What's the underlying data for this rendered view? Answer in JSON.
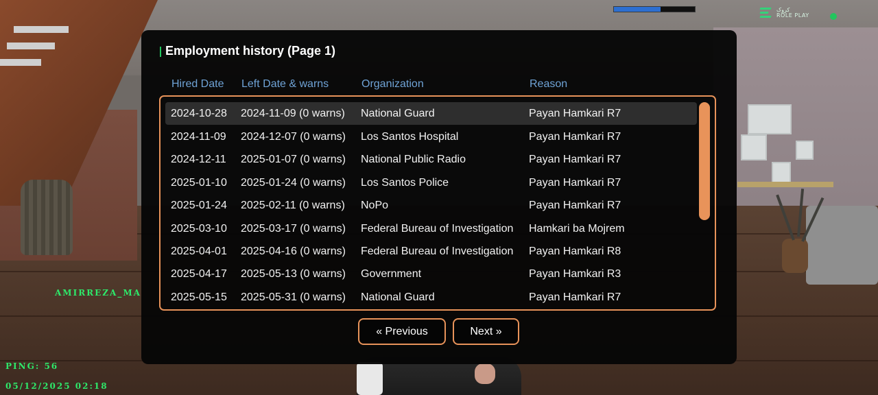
{
  "hud": {
    "health_fraction": 0.58,
    "health_color": "#2d6fd1",
    "logo_line1": "کروک",
    "logo_line2": "ROLE PLAY",
    "status_color": "#22c55e",
    "player_name": "AMIRREZA_MA",
    "ping": "PING: 56",
    "datetime": "05/12/2025 02:18"
  },
  "dialog": {
    "title": "Employment history (Page 1)",
    "columns": [
      "Hired Date",
      "Left Date & warns",
      "Organization",
      "Reason"
    ],
    "rows": [
      {
        "hired": "2024-10-28",
        "left": "2024-11-09 (0 warns)",
        "org": "National Guard",
        "reason": "Payan Hamkari R7"
      },
      {
        "hired": "2024-11-09",
        "left": "2024-12-07 (0 warns)",
        "org": "Los Santos Hospital",
        "reason": "Payan Hamkari R7"
      },
      {
        "hired": "2024-12-11",
        "left": "2025-01-07 (0 warns)",
        "org": "National Public Radio",
        "reason": "Payan Hamkari R7"
      },
      {
        "hired": "2025-01-10",
        "left": "2025-01-24 (0 warns)",
        "org": "Los Santos Police",
        "reason": "Payan Hamkari R7"
      },
      {
        "hired": "2025-01-24",
        "left": "2025-02-11 (0 warns)",
        "org": "NoPo",
        "reason": "Payan Hamkari R7"
      },
      {
        "hired": "2025-03-10",
        "left": "2025-03-17 (0 warns)",
        "org": "Federal Bureau of Investigation",
        "reason": "Hamkari ba Mojrem"
      },
      {
        "hired": "2025-04-01",
        "left": "2025-04-16 (0 warns)",
        "org": "Federal Bureau of Investigation",
        "reason": "Payan Hamkari R8"
      },
      {
        "hired": "2025-04-17",
        "left": "2025-05-13 (0 warns)",
        "org": "Government",
        "reason": "Payan Hamkari R3"
      },
      {
        "hired": "2025-05-15",
        "left": "2025-05-31 (0 warns)",
        "org": "National Guard",
        "reason": "Payan Hamkari R7"
      }
    ],
    "selected_row": 0,
    "prev_label": "« Previous",
    "next_label": "Next »",
    "accent_color": "#e8935a",
    "header_color": "#6fa3d6"
  }
}
